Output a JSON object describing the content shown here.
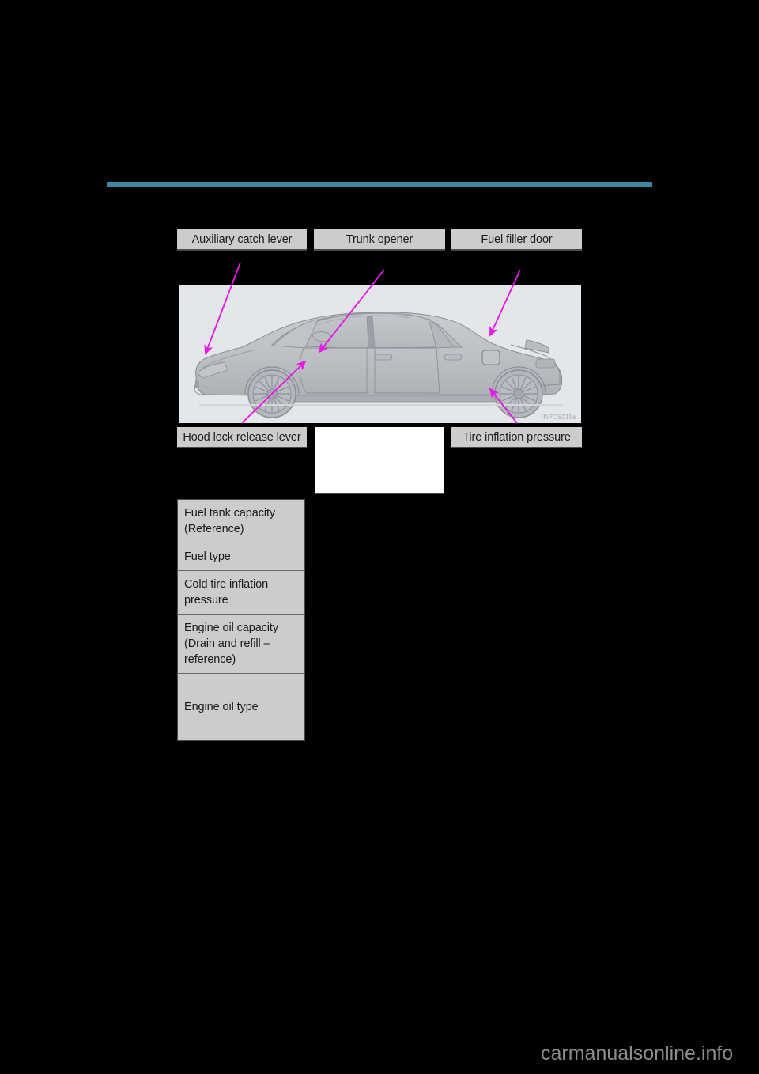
{
  "page": {
    "background_color": "#000000",
    "rule_color": "#3d87a0"
  },
  "callouts": {
    "top": [
      {
        "id": "auxiliary-catch-lever",
        "label": "Auxiliary catch lever"
      },
      {
        "id": "trunk-opener",
        "label": "Trunk opener"
      },
      {
        "id": "fuel-filler-door",
        "label": "Fuel filler door"
      }
    ],
    "bottom": [
      {
        "id": "hood-lock-release-lever",
        "label": "Hood lock release lever"
      },
      {
        "id": "blank-box",
        "label": ""
      },
      {
        "id": "tire-inflation-pressure",
        "label": "Tire inflation pressure"
      }
    ]
  },
  "illustration": {
    "caption_code": "INPCS015a",
    "alt": "Side view line drawing of a Lexus GS sedan",
    "panel_color": "#e4e7ea",
    "arrow_color": "#e619e6"
  },
  "spec_table": {
    "rows": [
      {
        "label": "Fuel tank capacity\n(Reference)"
      },
      {
        "label": "Fuel type"
      },
      {
        "label": "Cold tire inflation\npressure"
      },
      {
        "label": "Engine oil capacity\n(Drain and refill –\nreference)"
      },
      {
        "label": "Engine oil type"
      }
    ]
  },
  "watermark": {
    "site": "carmanualsonline.info"
  }
}
